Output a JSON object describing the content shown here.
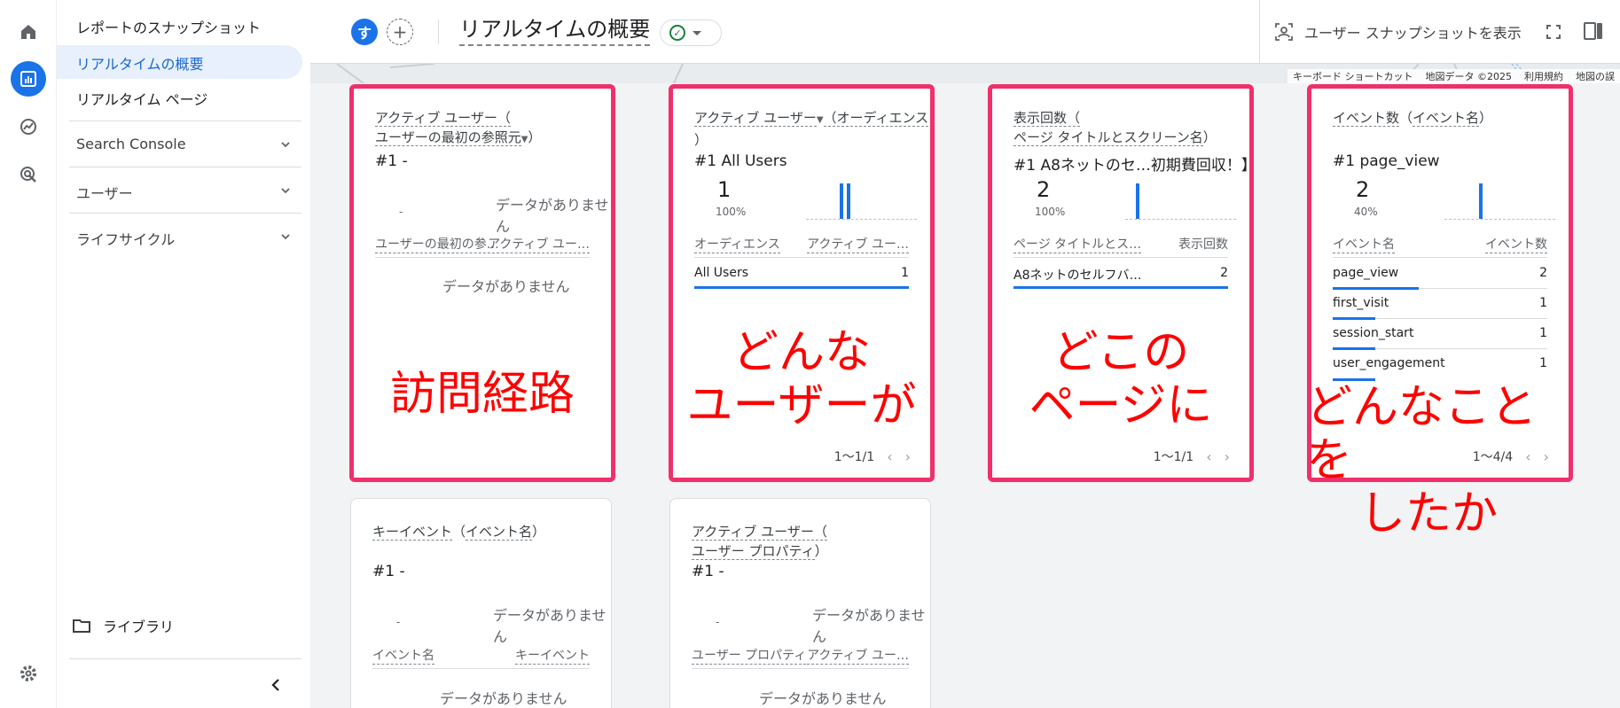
{
  "rail": {
    "icons": [
      "home-icon",
      "reports-icon",
      "explore-icon",
      "advertising-icon",
      "settings-icon"
    ]
  },
  "sidebar": {
    "items": [
      {
        "label": "レポートのスナップショット"
      },
      {
        "label": "リアルタイムの概要"
      },
      {
        "label": "リアルタイム ページ"
      }
    ],
    "sections": [
      {
        "label": "Search Console"
      },
      {
        "label": "ユーザー"
      },
      {
        "label": "ライフサイクル"
      }
    ],
    "library_label": "ライブラリ"
  },
  "header": {
    "avatar_letter": "す",
    "add_comparison": "+",
    "title": "リアルタイムの概要",
    "snapshot_label": "ユーザー スナップショットを表示"
  },
  "map_attribution": [
    "キーボード ショートカット",
    "地図データ ©2025",
    "利用規約",
    "地図の誤"
  ],
  "cards": {
    "source": {
      "title_line1": "アクティブ ユーザー（",
      "title_line2": "ユーザーの最初の参照元",
      "title_line2_end": "）",
      "rank": "#1 -",
      "dash": "-",
      "nodata_top": "データがありません",
      "col_left": "ユーザーの最初の参…",
      "col_right": "アクティブ ユー…",
      "nodata_table": "データがありません"
    },
    "audience": {
      "title_a": "アクティブ ユーザー",
      "title_b": "（オーディエンス",
      "title_c": "）",
      "rank": "#1  All Users",
      "value": "1",
      "pct": "100%",
      "col_left": "オーディエンス",
      "col_right": "アクティブ ユー…",
      "rows": [
        {
          "name": "All Users",
          "value": "1"
        }
      ],
      "pager": "1〜1/1"
    },
    "pages": {
      "title_line1": "表示回数（",
      "title_line2": "ページ タイトルとスクリーン名",
      "title_line2_end": "）",
      "rank": "#1  A8ネットのセ…初期費回収！】",
      "value": "2",
      "pct": "100%",
      "col_left": "ページ タイトルとス…",
      "col_right": "表示回数",
      "rows": [
        {
          "name": "A8ネットのセルフバ…",
          "value": "2"
        }
      ],
      "pager": "1〜1/1"
    },
    "events": {
      "title_a": "イベント数",
      "title_b": "（",
      "title_c": "イベント名",
      "title_d": "）",
      "rank": "#1  page_view",
      "value": "2",
      "pct": "40%",
      "col_left": "イベント名",
      "col_right": "イベント数",
      "rows": [
        {
          "name": "page_view",
          "value": "2",
          "share": 0.4
        },
        {
          "name": "first_visit",
          "value": "1",
          "share": 0.2
        },
        {
          "name": "session_start",
          "value": "1",
          "share": 0.2
        },
        {
          "name": "user_engagement",
          "value": "1",
          "share": 0.2
        }
      ],
      "pager": "1〜4/4"
    },
    "keyevents": {
      "title_a": "キーイベント",
      "title_b": "（",
      "title_c": "イベント名",
      "title_d": "）",
      "rank": "#1 -",
      "dash": "-",
      "nodata_top": "データがありません",
      "col_left": "イベント名",
      "col_right": "キーイベント",
      "nodata_table": "データがありません"
    },
    "userprop": {
      "title_line1": "アクティブ ユーザー（",
      "title_line2": "ユーザー プロパティ",
      "title_line2_end": "）",
      "rank": "#1 -",
      "dash": "-",
      "nodata_top": "データがありません",
      "col_left": "ユーザー プロパティ",
      "col_right": "アクティブ ユー…",
      "nodata_table": "データがありません"
    }
  },
  "annotations": {
    "a1": "訪問経路",
    "a2_1": "どんな",
    "a2_2": "ユーザーが",
    "a3_1": "どこの",
    "a3_2": "ページに",
    "a4_1": "どんなことを",
    "a4_2": "したか"
  },
  "colors": {
    "accent": "#1a73e8",
    "highlight_border": "#f0306a",
    "annotation": "#ff0000"
  }
}
